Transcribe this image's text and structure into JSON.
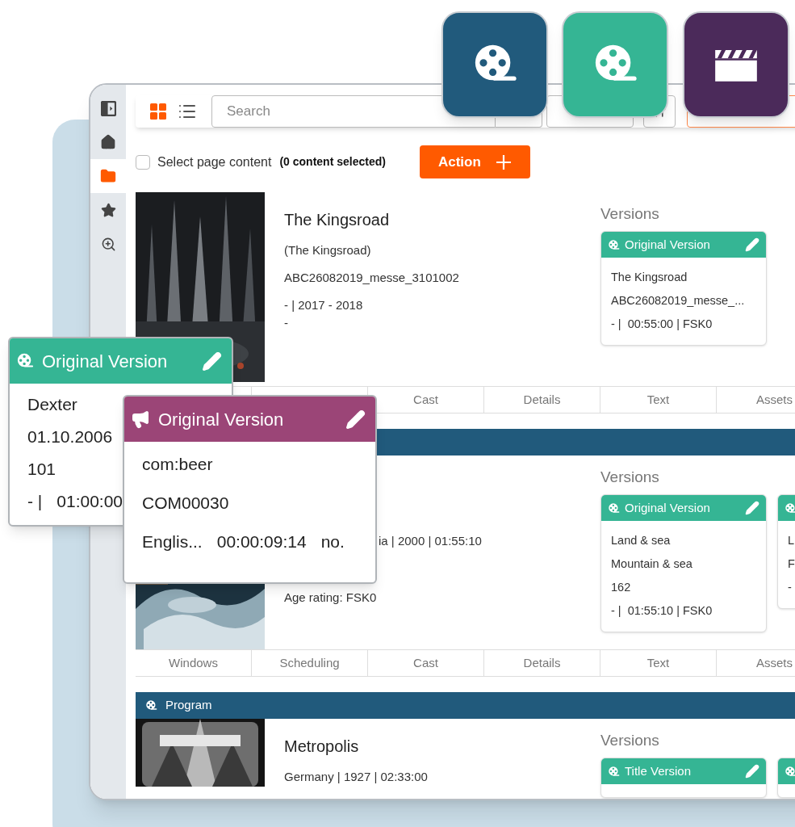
{
  "tiles": [
    {
      "kind": "reel",
      "color": "#215a7c"
    },
    {
      "kind": "reel",
      "color": "#35b594"
    },
    {
      "kind": "clapper",
      "color": "#4b2a5a"
    }
  ],
  "sidebar": {
    "items": [
      {
        "kind": "panel",
        "selected": false
      },
      {
        "kind": "home",
        "selected": false
      },
      {
        "kind": "folder",
        "selected": true
      },
      {
        "kind": "star",
        "selected": false
      },
      {
        "kind": "zoom",
        "selected": false
      }
    ]
  },
  "toolbar": {
    "views": [
      {
        "kind": "grid",
        "selected": true
      },
      {
        "kind": "list",
        "selected": false
      }
    ],
    "search": {
      "placeholder": "Search"
    }
  },
  "selection": {
    "checked": false,
    "label": "Select page content",
    "count": "(0 content selected)"
  },
  "action_button": "Action",
  "items": [
    {
      "title": "The Kingsroad",
      "lines": [
        {
          "kind": "meta",
          "text": "(The Kingsroad)"
        },
        {
          "kind": "meta",
          "text": "ABC26082019_messe_3101002"
        },
        {
          "kind": "meta",
          "text": "- | 2017 - 2018"
        },
        {
          "kind": "note",
          "text": "-"
        }
      ],
      "versions_label": "Versions",
      "versions": [
        {
          "kind": "reel",
          "title": "Original Version",
          "editable": true,
          "lines": [
            "The Kingsroad",
            "ABC26082019_messe_...",
            "- |  00:55:00 | FSK0"
          ]
        }
      ],
      "tabs": [
        "Cast",
        "Details",
        "Text",
        "Assets"
      ]
    },
    {
      "header": {
        "kind": "program"
      },
      "lines": [
        {
          "kind": "clipped",
          "text": "ia | 2000 | 01:55:10"
        },
        {
          "kind": "rating",
          "text": "Age rating: FSK0"
        }
      ],
      "versions_label": "Versions",
      "versions": [
        {
          "kind": "reel",
          "title": "Original Version",
          "editable": true,
          "lines": [
            "Land & sea",
            "Mountain & sea",
            "162",
            "- |  01:55:10 | FSK0"
          ]
        },
        {
          "kind": "reel",
          "editable": false,
          "lines": [
            "L",
            "F",
            "-"
          ]
        }
      ],
      "tabs": [
        "Windows",
        "Scheduling",
        "Cast",
        "Details",
        "Text",
        "Assets"
      ]
    },
    {
      "header": {
        "kind": "program",
        "label": "Program"
      },
      "title": "Metropolis",
      "lines": [
        {
          "kind": "meta",
          "text": "Germany | 1927 | 02:33:00"
        }
      ],
      "versions_label": "Versions",
      "versions": [
        {
          "kind": "reel",
          "title": "Title Version",
          "editable": true
        },
        {
          "kind": "reel",
          "editable": false
        }
      ]
    }
  ],
  "floating_cards": [
    {
      "kind": "reel",
      "color": "#35b594",
      "title": "Original Version",
      "editable": true,
      "lines": [
        [
          "Dexter"
        ],
        [
          "01.10.2006"
        ],
        [
          "101"
        ],
        [
          "- |",
          "01:00:00"
        ]
      ]
    },
    {
      "kind": "megaphone",
      "color": "#9b4577",
      "title": "Original Version",
      "editable": true,
      "lines": [
        [
          "com:beer"
        ],
        [
          "COM00030"
        ],
        [
          "Englis...",
          "00:00:09:14",
          "no."
        ]
      ]
    }
  ]
}
